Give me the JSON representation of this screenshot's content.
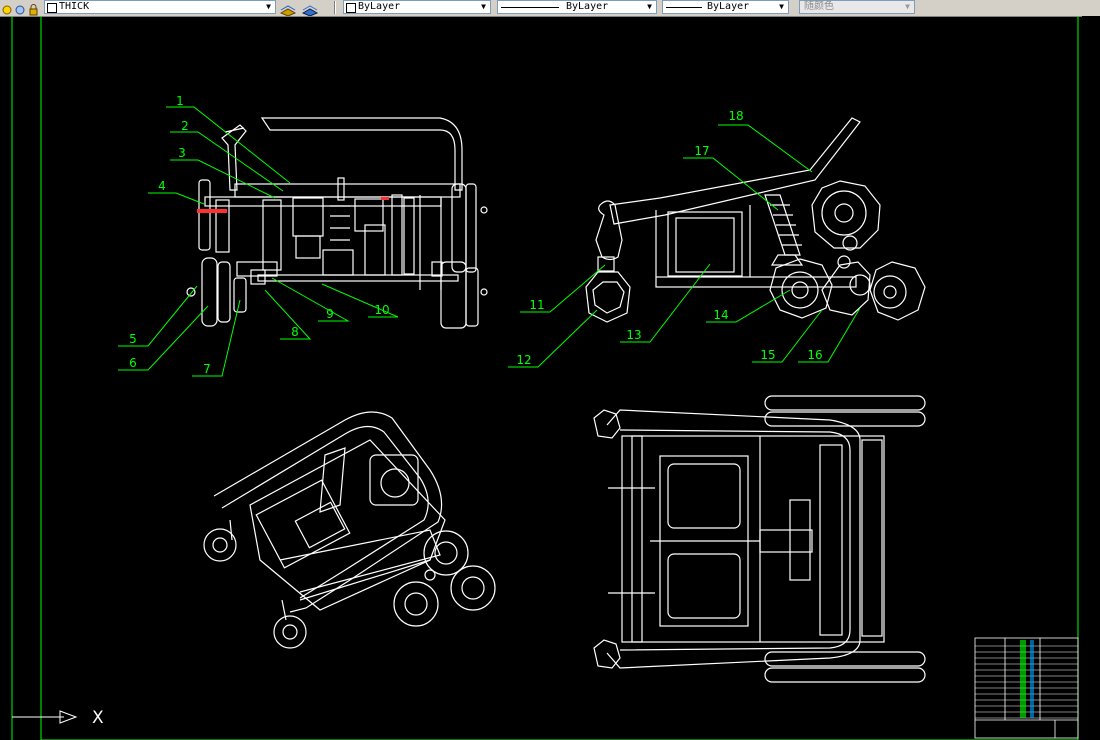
{
  "toolbar": {
    "layer_name": "THICK",
    "color_value": "ByLayer",
    "linetype_value": "ByLayer",
    "lineweight_value": "ByLayer",
    "plotstyle_value": "随颜色"
  },
  "drawing": {
    "balloons": [
      "1",
      "2",
      "3",
      "4",
      "5",
      "6",
      "7",
      "8",
      "9",
      "10",
      "11",
      "12",
      "13",
      "14",
      "15",
      "16",
      "17",
      "18"
    ],
    "ucs_axis_label": "X"
  },
  "colors": {
    "background": "#000000",
    "geometry": "#ffffff",
    "leaders": "#00ff00",
    "highlight": "#ff3030"
  }
}
